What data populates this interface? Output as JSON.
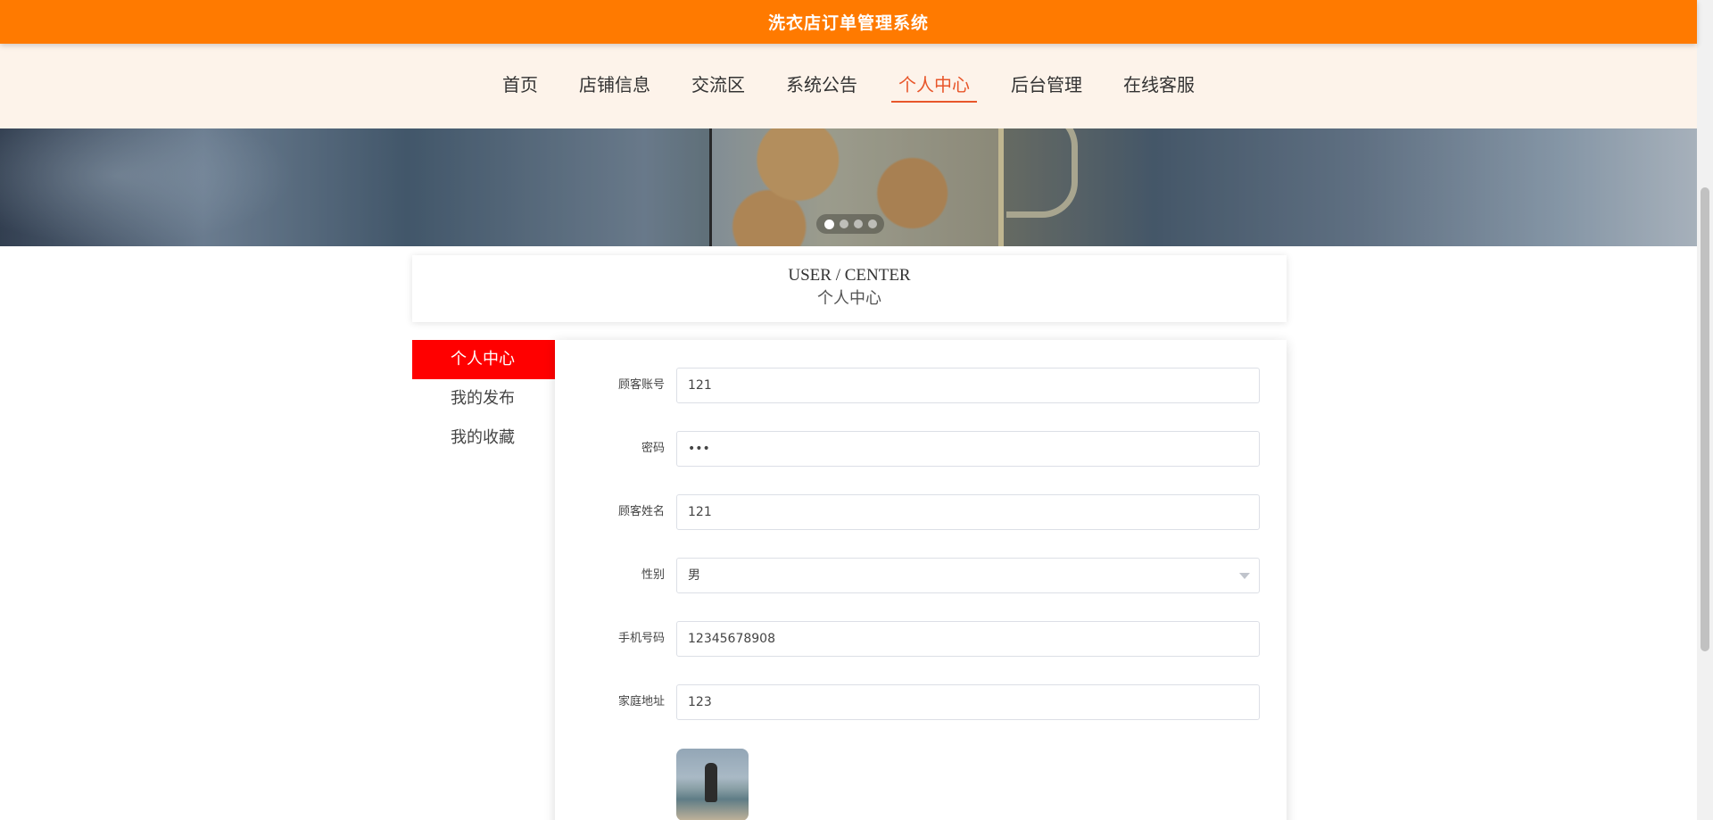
{
  "app": {
    "title": "洗衣店订单管理系统"
  },
  "nav": {
    "items": [
      {
        "label": "首页"
      },
      {
        "label": "店铺信息"
      },
      {
        "label": "交流区"
      },
      {
        "label": "系统公告"
      },
      {
        "label": "个人中心",
        "active": true
      },
      {
        "label": "后台管理"
      },
      {
        "label": "在线客服"
      }
    ]
  },
  "carousel": {
    "slide_count": 4,
    "active_index": 0
  },
  "section": {
    "title_en": "USER / CENTER",
    "title_cn": "个人中心"
  },
  "side_menu": {
    "items": [
      {
        "label": "个人中心",
        "active": true
      },
      {
        "label": "我的发布"
      },
      {
        "label": "我的收藏"
      }
    ]
  },
  "form": {
    "account": {
      "label": "顾客账号",
      "value": "121"
    },
    "password": {
      "label": "密码",
      "value": "•••"
    },
    "name": {
      "label": "顾客姓名",
      "value": "121"
    },
    "gender": {
      "label": "性别",
      "value": "男"
    },
    "phone": {
      "label": "手机号码",
      "value": "12345678908"
    },
    "address": {
      "label": "家庭地址",
      "value": "123"
    }
  },
  "colors": {
    "topbar": "#ff7a00",
    "nav_bg": "#fdf3ea",
    "nav_active": "#e8562a",
    "side_active": "#ff0000"
  }
}
